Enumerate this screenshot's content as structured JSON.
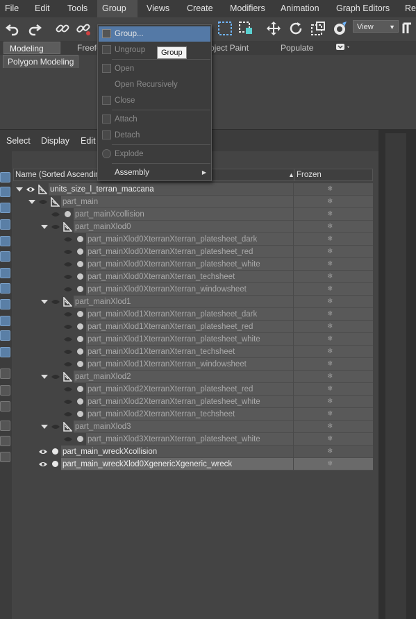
{
  "menubar": {
    "items": [
      "File",
      "Edit",
      "Tools",
      "Group",
      "Views",
      "Create",
      "Modifiers",
      "Animation",
      "Graph Editors",
      "Ren"
    ]
  },
  "toolbar": {
    "view_select": "View",
    "icons": [
      "undo-icon",
      "redo-icon",
      "link-icon",
      "unlink-icon",
      "select-region-icon",
      "window-crossing-icon",
      "move-icon",
      "rotate-icon",
      "scale-icon",
      "snap-icon"
    ]
  },
  "ribbon": {
    "tabs": [
      "Modeling",
      "Freefo",
      "oject Paint",
      "Populate"
    ],
    "active_panel": "Polygon Modeling"
  },
  "scene_explorer": {
    "toolbar": [
      "Select",
      "Display",
      "Edit"
    ],
    "columns": {
      "name": "Name (Sorted Ascending",
      "frozen": "Frozen"
    },
    "frozen_glyph": "❄",
    "rows": [
      {
        "label": "units_size_l_terran_maccana",
        "style": "bright"
      },
      {
        "label": "part_main",
        "style": "dim"
      },
      {
        "label": "part_mainXcollision",
        "style": "dim"
      },
      {
        "label": "part_mainXlod0",
        "style": "dim"
      },
      {
        "label": "part_mainXlod0XterranXterran_platesheet_dark",
        "style": "dim"
      },
      {
        "label": "part_mainXlod0XterranXterran_platesheet_red",
        "style": "dim"
      },
      {
        "label": "part_mainXlod0XterranXterran_platesheet_white",
        "style": "dim"
      },
      {
        "label": "part_mainXlod0XterranXterran_techsheet",
        "style": "dim"
      },
      {
        "label": "part_mainXlod0XterranXterran_windowsheet",
        "style": "dim"
      },
      {
        "label": "part_mainXlod1",
        "style": "dim"
      },
      {
        "label": "part_mainXlod1XterranXterran_platesheet_dark",
        "style": "dim"
      },
      {
        "label": "part_mainXlod1XterranXterran_platesheet_red",
        "style": "dim"
      },
      {
        "label": "part_mainXlod1XterranXterran_platesheet_white",
        "style": "dim"
      },
      {
        "label": "part_mainXlod1XterranXterran_techsheet",
        "style": "dim"
      },
      {
        "label": "part_mainXlod1XterranXterran_windowsheet",
        "style": "dim"
      },
      {
        "label": "part_mainXlod2",
        "style": "dim"
      },
      {
        "label": "part_mainXlod2XterranXterran_platesheet_red",
        "style": "dim"
      },
      {
        "label": "part_mainXlod2XterranXterran_platesheet_white",
        "style": "dim"
      },
      {
        "label": "part_mainXlod2XterranXterran_techsheet",
        "style": "dim"
      },
      {
        "label": "part_mainXlod3",
        "style": "dim"
      },
      {
        "label": "part_mainXlod3XterranXterran_platesheet_white",
        "style": "dim"
      },
      {
        "label": "part_main_wreckXcollision",
        "style": "bright"
      },
      {
        "label": "part_main_wreckXlod0XgenericXgeneric_wreck",
        "style": "selected"
      }
    ]
  },
  "group_menu": {
    "items": [
      {
        "label": "Group...",
        "state": "highlighted"
      },
      {
        "label": "Ungroup",
        "state": "disabled"
      },
      {
        "label": "Open",
        "state": "disabled"
      },
      {
        "label": "Open Recursively",
        "state": "disabled"
      },
      {
        "label": "Close",
        "state": "disabled"
      },
      {
        "label": "Attach",
        "state": "disabled"
      },
      {
        "label": "Detach",
        "state": "disabled"
      },
      {
        "label": "Explode",
        "state": "disabled"
      },
      {
        "label": "Assembly",
        "state": "enabled"
      }
    ],
    "tooltip": "Group"
  },
  "colors": {
    "highlight": "#5479a6",
    "background": "#444444",
    "menubar": "#3b3b3b"
  }
}
